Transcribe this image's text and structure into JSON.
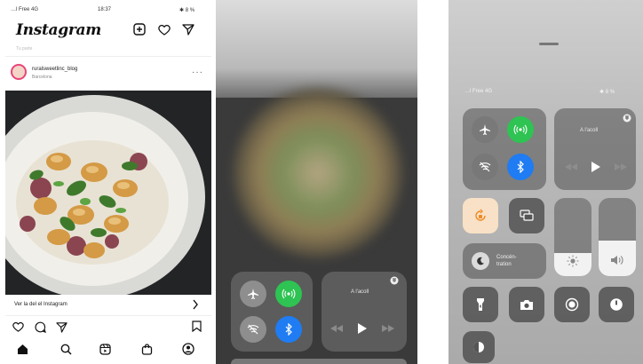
{
  "instagram": {
    "status_left": "…l Free  4G",
    "status_time": "18:37",
    "status_right": "✱ 8 %",
    "logo": "Instagram",
    "sub_line": "Tu parte",
    "username": "ruralsweetlinc_blog",
    "location": "Barcelona",
    "link_text": "Ver la del el Instagram",
    "icons": [
      "new-post-icon",
      "heart-icon",
      "send-icon",
      "like-icon",
      "comment-icon",
      "share-icon",
      "bookmark-icon",
      "home-icon",
      "search-icon",
      "reels-icon",
      "shop-icon",
      "profile-icon"
    ]
  },
  "control_center_mid": {
    "now_playing": "A l'acoll",
    "icons": [
      "airplane-icon",
      "cellular-icon",
      "wifi-off-icon",
      "bluetooth-icon",
      "rewind-icon",
      "play-icon",
      "forward-icon",
      "airplay-icon"
    ]
  },
  "control_center_right": {
    "status_left": "…l Free 4G",
    "status_right": "✱ 8 %",
    "now_playing": "A l'acoll",
    "focus_label": "Concén- tration",
    "icons": [
      "airplane-icon",
      "cellular-icon",
      "wifi-off-icon",
      "bluetooth-icon",
      "orientation-lock-icon",
      "screen-mirroring-icon",
      "moon-icon",
      "brightness-icon",
      "volume-icon",
      "flashlight-icon",
      "camera-icon",
      "record-icon",
      "timer-icon",
      "extra-icon"
    ]
  },
  "colors": {
    "green": "#2ec352",
    "blue": "#1f7cf2",
    "orange_tile": "#f8e1c6",
    "orange_icon": "#f08a24"
  }
}
